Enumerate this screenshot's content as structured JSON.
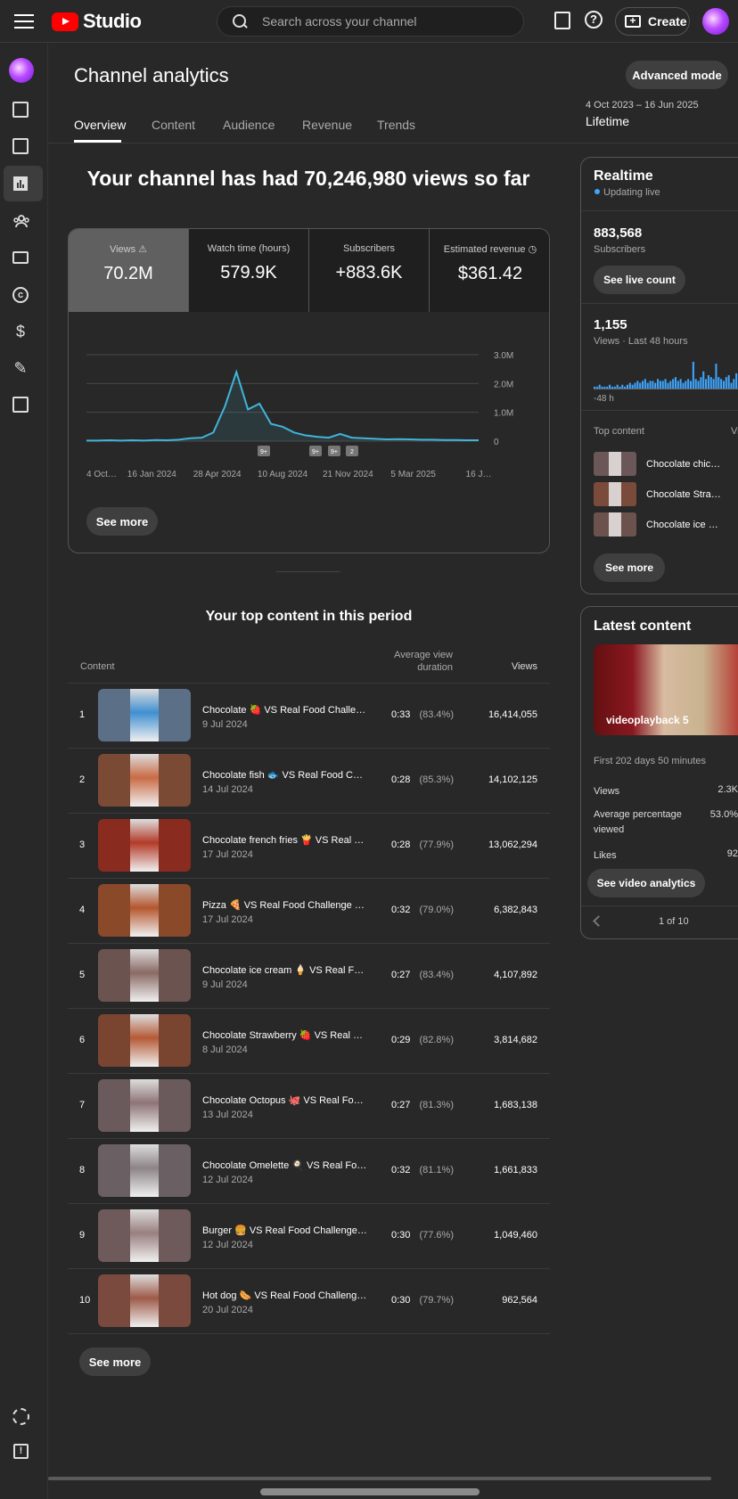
{
  "search": {
    "placeholder": "Search across your channel"
  },
  "header": {
    "brand": "Studio",
    "create_label": "Create",
    "help_glyph": "?"
  },
  "page": {
    "title": "Channel analytics",
    "advanced_mode": "Advanced mode",
    "date_range": "4 Oct 2023 – 16 Jun 2025",
    "period": "Lifetime",
    "tabs": [
      "Overview",
      "Content",
      "Audience",
      "Revenue",
      "Trends"
    ]
  },
  "headline": "Your channel has had 70,246,980 views so far",
  "metrics": [
    {
      "label": "Views",
      "value": "70.2M"
    },
    {
      "label": "Watch time (hours)",
      "value": "579.9K"
    },
    {
      "label": "Subscribers",
      "value": "+883.6K"
    },
    {
      "label": "Estimated revenue",
      "value": "$361.42"
    }
  ],
  "chart_data": {
    "type": "line",
    "series": [
      {
        "values": [
          0.02,
          0.02,
          0.03,
          0.02,
          0.03,
          0.02,
          0.04,
          0.03,
          0.05,
          0.1,
          0.12,
          0.3,
          1.2,
          2.4,
          1.1,
          1.3,
          0.6,
          0.5,
          0.3,
          0.2,
          0.15,
          0.12,
          0.25,
          0.12,
          0.1,
          0.08,
          0.06,
          0.07,
          0.06,
          0.05,
          0.05,
          0.04,
          0.04,
          0.03,
          0.03
        ]
      }
    ],
    "x_ticks": [
      "4 Oct…",
      "16 Jan 2024",
      "28 Apr 2024",
      "10 Aug 2024",
      "21 Nov 2024",
      "5 Mar 2025",
      "16 J…"
    ],
    "y_ticks": [
      "3.0M",
      "2.0M",
      "1.0M",
      "0"
    ],
    "ylim": [
      0,
      3.0
    ],
    "annotations": [
      "9+",
      "9+",
      "9+",
      "2"
    ],
    "color": "#41b4d9"
  },
  "see_more": "See more",
  "top_content": {
    "title": "Your top content in this period",
    "col_content": "Content",
    "col_avd": "Average view duration",
    "col_views": "Views",
    "rows": [
      {
        "rank": "1",
        "title": "Chocolate 🍓 VS Real Food Challen…",
        "date": "9 Jul 2024",
        "dur": "0:33",
        "pct": "(83.4%)",
        "views": "16,414,055"
      },
      {
        "rank": "2",
        "title": "Chocolate fish 🐟 VS Real Food Ch…",
        "date": "14 Jul 2024",
        "dur": "0:28",
        "pct": "(85.3%)",
        "views": "14,102,125"
      },
      {
        "rank": "3",
        "title": "Chocolate french fries 🍟 VS Real F…",
        "date": "17 Jul 2024",
        "dur": "0:28",
        "pct": "(77.9%)",
        "views": "13,062,294"
      },
      {
        "rank": "4",
        "title": "Pizza 🍕 VS Real Food Challenge P…",
        "date": "17 Jul 2024",
        "dur": "0:32",
        "pct": "(79.0%)",
        "views": "6,382,843"
      },
      {
        "rank": "5",
        "title": "Chocolate ice cream 🍦 VS Real Fo…",
        "date": "9 Jul 2024",
        "dur": "0:27",
        "pct": "(83.4%)",
        "views": "4,107,892"
      },
      {
        "rank": "6",
        "title": "Chocolate Strawberry 🍓 VS Real F…",
        "date": "8 Jul 2024",
        "dur": "0:29",
        "pct": "(82.8%)",
        "views": "3,814,682"
      },
      {
        "rank": "7",
        "title": "Chocolate Octopus 🐙 VS Real Foo…",
        "date": "13 Jul 2024",
        "dur": "0:27",
        "pct": "(81.3%)",
        "views": "1,683,138"
      },
      {
        "rank": "8",
        "title": "Chocolate Omelette 🍳 VS Real Foo…",
        "date": "12 Jul 2024",
        "dur": "0:32",
        "pct": "(81.1%)",
        "views": "1,661,833"
      },
      {
        "rank": "9",
        "title": "Burger 🍔 VS Real Food Challenge …",
        "date": "12 Jul 2024",
        "dur": "0:30",
        "pct": "(77.6%)",
        "views": "1,049,460"
      },
      {
        "rank": "10",
        "title": "Hot dog 🌭 VS Real Food Challenge…",
        "date": "20 Jul 2024",
        "dur": "0:30",
        "pct": "(79.7%)",
        "views": "962,564"
      }
    ]
  },
  "realtime": {
    "title": "Realtime",
    "live": "Updating live",
    "subs_value": "883,568",
    "subs_label": "Subscribers",
    "live_count_btn": "See live count",
    "views_value": "1,155",
    "views_label": "Views · Last 48 hours",
    "bars": [
      1,
      1,
      2,
      1,
      1,
      1,
      2,
      1,
      1,
      2,
      1,
      2,
      1,
      2,
      3,
      2,
      3,
      4,
      3,
      4,
      5,
      3,
      4,
      4,
      3,
      5,
      4,
      4,
      5,
      3,
      4,
      5,
      6,
      4,
      5,
      3,
      4,
      5,
      4,
      14,
      5,
      4,
      6,
      9,
      5,
      7,
      6,
      5,
      13,
      6,
      5,
      4,
      6,
      7,
      3,
      5,
      8
    ],
    "h48": "-48 h",
    "top_content": "Top content",
    "col_cut": "Vi",
    "items": [
      "Chocolate chic…",
      "Chocolate Stra…",
      "Chocolate ice …"
    ]
  },
  "latest": {
    "title": "Latest content",
    "video_title": "videoplayback 5",
    "first": "First 202 days 50 minutes",
    "stats": [
      {
        "label": "Views",
        "value": "2.3K"
      },
      {
        "label": "Average percentage viewed",
        "value": "53.0%"
      },
      {
        "label": "Likes",
        "value": "92"
      }
    ],
    "analytics_btn": "See video analytics",
    "pager": "1 of 10"
  }
}
